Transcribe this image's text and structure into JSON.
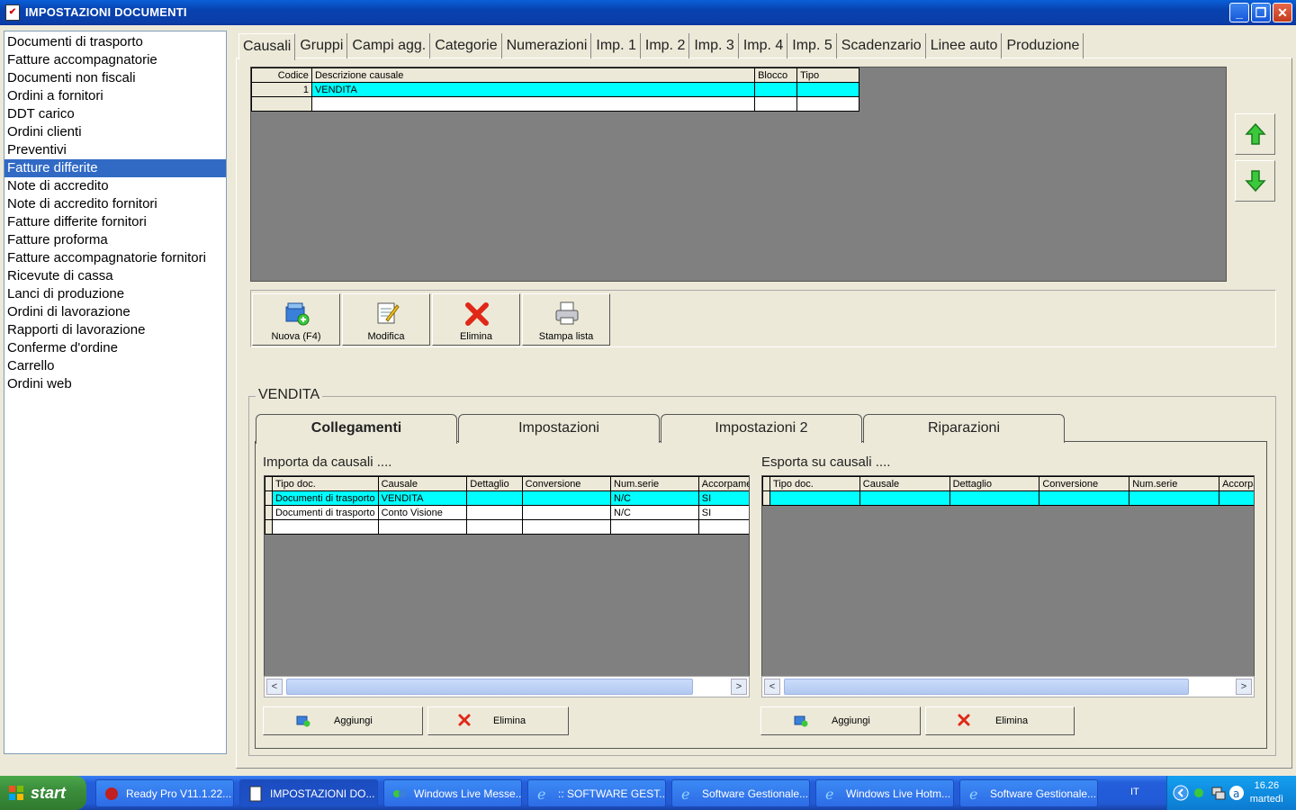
{
  "window": {
    "title": "IMPOSTAZIONI DOCUMENTI"
  },
  "doclist": [
    "Documenti di trasporto",
    "Fatture accompagnatorie",
    "Documenti non fiscali",
    "Ordini a fornitori",
    "DDT carico",
    "Ordini clienti",
    "Preventivi",
    "Fatture differite",
    "Note di accredito",
    "Note di accredito fornitori",
    "Fatture differite fornitori",
    "Fatture proforma",
    "Fatture accompagnatorie fornitori",
    "Ricevute di cassa",
    "Lanci di produzione",
    "Ordini di lavorazione",
    "Rapporti di lavorazione",
    "Conferme d'ordine",
    "Carrello",
    "Ordini web"
  ],
  "doclist_selected": "Fatture differite",
  "tabs": [
    "Causali",
    "Gruppi",
    "Campi agg.",
    "Categorie",
    "Numerazioni",
    "Imp. 1",
    "Imp. 2",
    "Imp. 3",
    "Imp. 4",
    "Imp. 5",
    "Scadenzario",
    "Linee auto",
    "Produzione"
  ],
  "active_tab": "Causali",
  "causali_grid": {
    "headers": {
      "codice": "Codice",
      "descrizione": "Descrizione causale",
      "blocco": "Blocco",
      "tipo": "Tipo"
    },
    "rows": [
      {
        "codice": "1",
        "descrizione": "VENDITA",
        "blocco": "",
        "tipo": ""
      }
    ]
  },
  "toolbar": {
    "new": "Nuova (F4)",
    "edit": "Modifica",
    "delete": "Elimina",
    "print": "Stampa lista"
  },
  "group_title": "VENDITA",
  "subtabs": [
    "Collegamenti",
    "Impostazioni",
    "Impostazioni 2",
    "Riparazioni"
  ],
  "active_subtab": "Collegamenti",
  "import": {
    "label": "Importa da causali ....",
    "headers": [
      "Tipo doc.",
      "Causale",
      "Dettaglio",
      "Conversione",
      "Num.serie",
      "Accorpame"
    ],
    "rows": [
      [
        "Documenti di trasporto",
        "VENDITA",
        "",
        "",
        "N/C",
        "SI"
      ],
      [
        "Documenti di trasporto",
        "Conto Visione",
        "",
        "",
        "N/C",
        "SI"
      ]
    ],
    "add": "Aggiungi",
    "delete": "Elimina"
  },
  "export": {
    "label": "Esporta su causali ....",
    "headers": [
      "Tipo doc.",
      "Causale",
      "Dettaglio",
      "Conversione",
      "Num.serie",
      "Accorpa"
    ],
    "add": "Aggiungi",
    "delete": "Elimina"
  },
  "taskbar": {
    "start": "start",
    "tasks": [
      "Ready Pro V11.1.22...",
      "IMPOSTAZIONI DO...",
      "Windows Live Messe...",
      ":: SOFTWARE GEST...",
      "Software Gestionale...",
      "Windows Live Hotm...",
      "Software Gestionale..."
    ],
    "lang": "IT",
    "time": "16.26",
    "day": "martedì"
  },
  "colors": {
    "selection": "#316ac5",
    "grid_highlight": "#00ffff",
    "title_bar": "#0842b0",
    "taskbar": "#245edb"
  }
}
